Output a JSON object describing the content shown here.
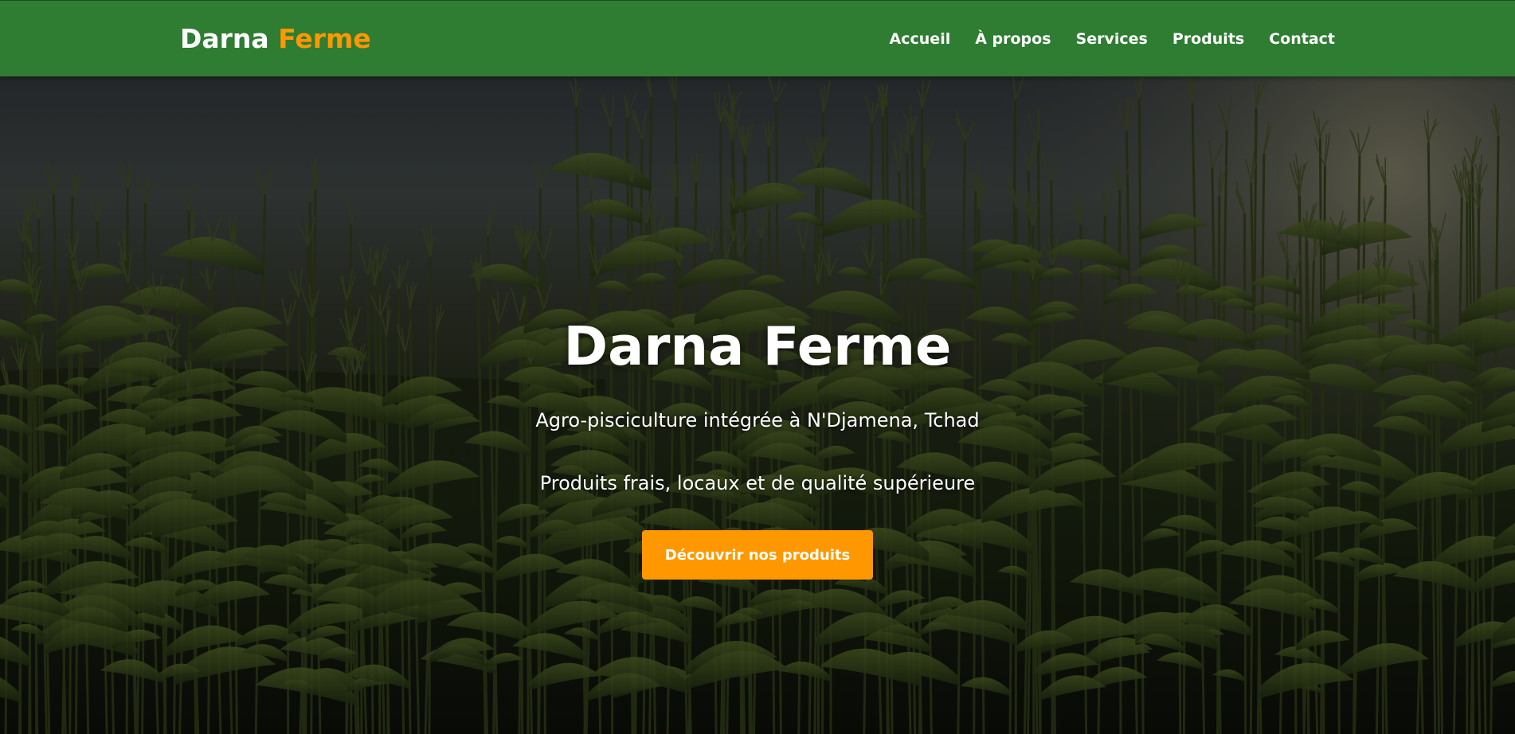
{
  "colors": {
    "nav_bg": "#2e7d32",
    "accent": "#ff9800",
    "text": "#ffffff"
  },
  "nav": {
    "logo_main": "Darna ",
    "logo_accent": "Ferme",
    "links": [
      {
        "label": "Accueil"
      },
      {
        "label": "À propos"
      },
      {
        "label": "Services"
      },
      {
        "label": "Produits"
      },
      {
        "label": "Contact"
      }
    ]
  },
  "hero": {
    "title": "Darna Ferme",
    "subtitle1": "Agro-pisciculture intégrée à N'Djamena, Tchad",
    "subtitle2": "Produits frais, locaux et de qualité supérieure",
    "cta_label": "Découvrir nos produits",
    "background": "cornfield-at-dusk"
  }
}
